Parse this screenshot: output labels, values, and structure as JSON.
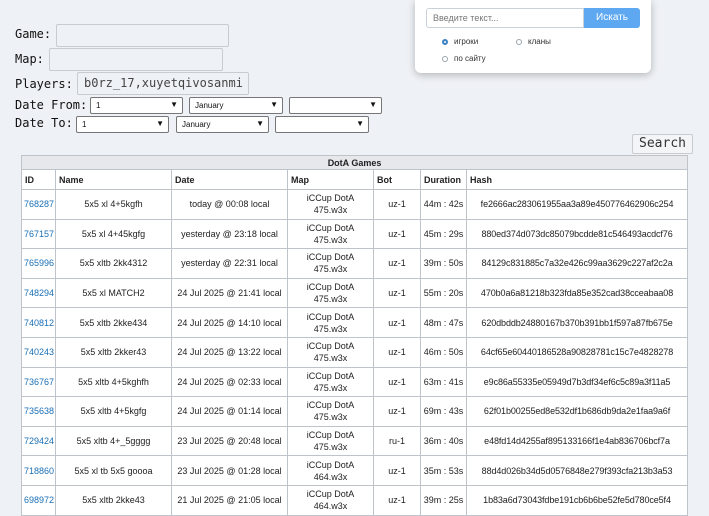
{
  "filters": {
    "game_label": "Game:",
    "map_label": "Map:",
    "players_label": "Players:",
    "players_value": "b0rz_17,xuyetqivosanmi",
    "date_from_label": "Date From:",
    "date_to_label": "Date To:",
    "from_day": "1",
    "from_month": "January",
    "from_year": "",
    "to_day": "1",
    "to_month": "January",
    "to_year": "",
    "search_button": "Search"
  },
  "popup": {
    "placeholder": "Введите текст...",
    "button": "Искать",
    "radio_players": "игроки",
    "radio_clans": "кланы",
    "radio_site": "по сайту",
    "selected": "игроки"
  },
  "table": {
    "caption": "DotA Games",
    "headers": [
      "ID",
      "Name",
      "Date",
      "Map",
      "Bot",
      "Duration",
      "Hash"
    ],
    "rows": [
      {
        "id": "768287",
        "name": "5x5 xl 4+5kgfh",
        "date": "today @ 00:08 local",
        "map": "iCCup DotA 475.w3x",
        "bot": "uz-1",
        "duration": "44m : 42s",
        "hash": "fe2666ac283061955aa3a89e450776462906c254"
      },
      {
        "id": "767157",
        "name": "5x5 xl 4+45kgfg",
        "date": "yesterday @ 23:18 local",
        "map": "iCCup DotA 475.w3x",
        "bot": "uz-1",
        "duration": "45m : 29s",
        "hash": "880ed374d073dc85079bcdde81c546493acdcf76"
      },
      {
        "id": "765996",
        "name": "5x5 xltb 2kk4312",
        "date": "yesterday @ 22:31 local",
        "map": "iCCup DotA 475.w3x",
        "bot": "uz-1",
        "duration": "39m : 50s",
        "hash": "84129c831885c7a32e426c99aa3629c227af2c2a"
      },
      {
        "id": "748294",
        "name": "5x5 xl MATCH2",
        "date": "24 Jul 2025 @ 21:41 local",
        "map": "iCCup DotA 475.w3x",
        "bot": "uz-1",
        "duration": "55m : 20s",
        "hash": "470b0a6a81218b323fda85e352cad38cceabaa08"
      },
      {
        "id": "740812",
        "name": "5x5 xltb 2kke434",
        "date": "24 Jul 2025 @ 14:10 local",
        "map": "iCCup DotA 475.w3x",
        "bot": "uz-1",
        "duration": "48m : 47s",
        "hash": "620dbddb24880167b370b391bb1f597a87fb675e"
      },
      {
        "id": "740243",
        "name": "5x5 xltb 2kker43",
        "date": "24 Jul 2025 @ 13:22 local",
        "map": "iCCup DotA 475.w3x",
        "bot": "uz-1",
        "duration": "46m : 50s",
        "hash": "64cf65e60440186528a90828781c15c7e4828278"
      },
      {
        "id": "736767",
        "name": "5x5 xltb 4+5kghfh",
        "date": "24 Jul 2025 @ 02:33 local",
        "map": "iCCup DotA 475.w3x",
        "bot": "uz-1",
        "duration": "63m : 41s",
        "hash": "e9c86a55335e05949d7b3df34ef6c5c89a3f11a5"
      },
      {
        "id": "735638",
        "name": "5x5 xltb 4+5kgfg",
        "date": "24 Jul 2025 @ 01:14 local",
        "map": "iCCup DotA 475.w3x",
        "bot": "uz-1",
        "duration": "69m : 43s",
        "hash": "62f01b00255ed8e532df1b686db9da2e1faa9a6f"
      },
      {
        "id": "729424",
        "name": "5x5 xltb 4+_5gggg",
        "date": "23 Jul 2025 @ 20:48 local",
        "map": "iCCup DotA 475.w3x",
        "bot": "ru-1",
        "duration": "36m : 40s",
        "hash": "e48fd14d4255af895133166f1e4ab836706bcf7a"
      },
      {
        "id": "718860",
        "name": "5x5 xl tb 5x5 goooa",
        "date": "23 Jul 2025 @ 01:28 local",
        "map": "iCCup DotA 464.w3x",
        "bot": "uz-1",
        "duration": "35m : 53s",
        "hash": "88d4d026b34d5d0576848e279f393cfa213b3a53"
      },
      {
        "id": "698972",
        "name": "5x5 xltb 2kke43",
        "date": "21 Jul 2025 @ 21:05 local",
        "map": "iCCup DotA 464.w3x",
        "bot": "uz-1",
        "duration": "39m : 25s",
        "hash": "1b83a6d73043fdbe191cb6b6be52fe5d780ce5f4"
      }
    ]
  },
  "icons": {
    "select_caret": "chevron-down-icon",
    "radio_selected": "radio-on-icon",
    "radio_unselected": "radio-off-icon"
  },
  "colors": {
    "page_bg": "#eef1f5",
    "link": "#1a6fb5",
    "popup_button": "#5da8f0"
  }
}
